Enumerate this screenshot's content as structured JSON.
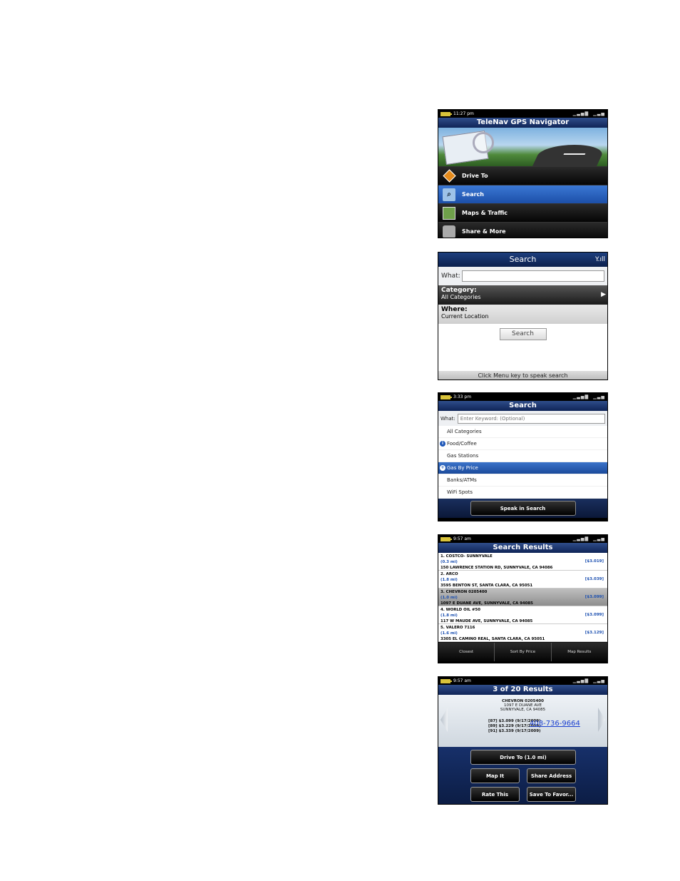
{
  "screen1": {
    "status_time": "11:27 pm",
    "title": "TeleNav GPS Navigator",
    "menu": [
      {
        "label": "Drive To"
      },
      {
        "label": "Search"
      },
      {
        "label": "Maps & Traffic"
      },
      {
        "label": "Share & More"
      }
    ]
  },
  "screen2": {
    "title": "Search",
    "what_label": "What:",
    "what_value": "",
    "category_label": "Category:",
    "category_value": "All Categories",
    "where_label": "Where:",
    "where_value": "Current Location",
    "search_button": "Search",
    "footer": "Click Menu key to speak search"
  },
  "screen3": {
    "status_time": "3:33 pm",
    "title": "Search",
    "what_label": "What:",
    "what_placeholder": "Enter Keyword: (Optional)",
    "categories": [
      {
        "label": "All Categories"
      },
      {
        "label": "Food/Coffee"
      },
      {
        "label": "Gas Stations"
      },
      {
        "label": "Gas By Price"
      },
      {
        "label": "Banks/ATMs"
      },
      {
        "label": "WiFi Spots"
      }
    ],
    "speak_button": "Speak in Search"
  },
  "screen4": {
    "status_time": "9:57 am",
    "title": "Search Results",
    "results": [
      {
        "name": "1. COSTCO- SUNNYVALE",
        "distance": "(0.3 mi)",
        "address": "150 LAWRENCE STATION RD, SUNNYVALE, CA 94086",
        "price": "[$3.019]"
      },
      {
        "name": "2. ARCO",
        "distance": "(1.8 mi)",
        "address": "3595 BENTON ST, SANTA CLARA, CA 95051",
        "price": "[$3.039]"
      },
      {
        "name": "3. CHEVRON 0205400",
        "distance": "(1.0 mi)",
        "address": "1097 E DUANE AVE, SUNNYVALE, CA 94085",
        "price": "[$3.099]"
      },
      {
        "name": "4. WORLD OIL #50",
        "distance": "(1.8 mi)",
        "address": "117 W MAUDE AVE, SUNNYVALE, CA 94085",
        "price": "[$3.099]"
      },
      {
        "name": "5. VALERO 7116",
        "distance": "(1.6 mi)",
        "address": "3305 EL CAMINO REAL, SANTA CLARA, CA 95051",
        "price": "[$3.129]"
      }
    ],
    "tabs": [
      {
        "label": "Closest"
      },
      {
        "label": "Sort By Price"
      },
      {
        "label": "Map Results"
      }
    ]
  },
  "screen5": {
    "status_time": "9:57 am",
    "title": "3 of 20 Results",
    "name": "CHEVRON 0205400",
    "address_line1": "1097 E DUANE AVE",
    "address_line2": "SUNNYVALE, CA 94085",
    "prices": [
      {
        "text": "[87] $3.099 (9/17/2009)"
      },
      {
        "text": "[89] $3.229 (9/17/2009)"
      },
      {
        "text": "[91] $3.339 (9/17/2009)"
      }
    ],
    "phone": "408-736-9664",
    "buttons": {
      "drive_to": "Drive To   (1.0 mi)",
      "map_it": "Map It",
      "share_address": "Share Address",
      "rate_this": "Rate This",
      "save_to_favorites": "Save To Favor..."
    }
  }
}
